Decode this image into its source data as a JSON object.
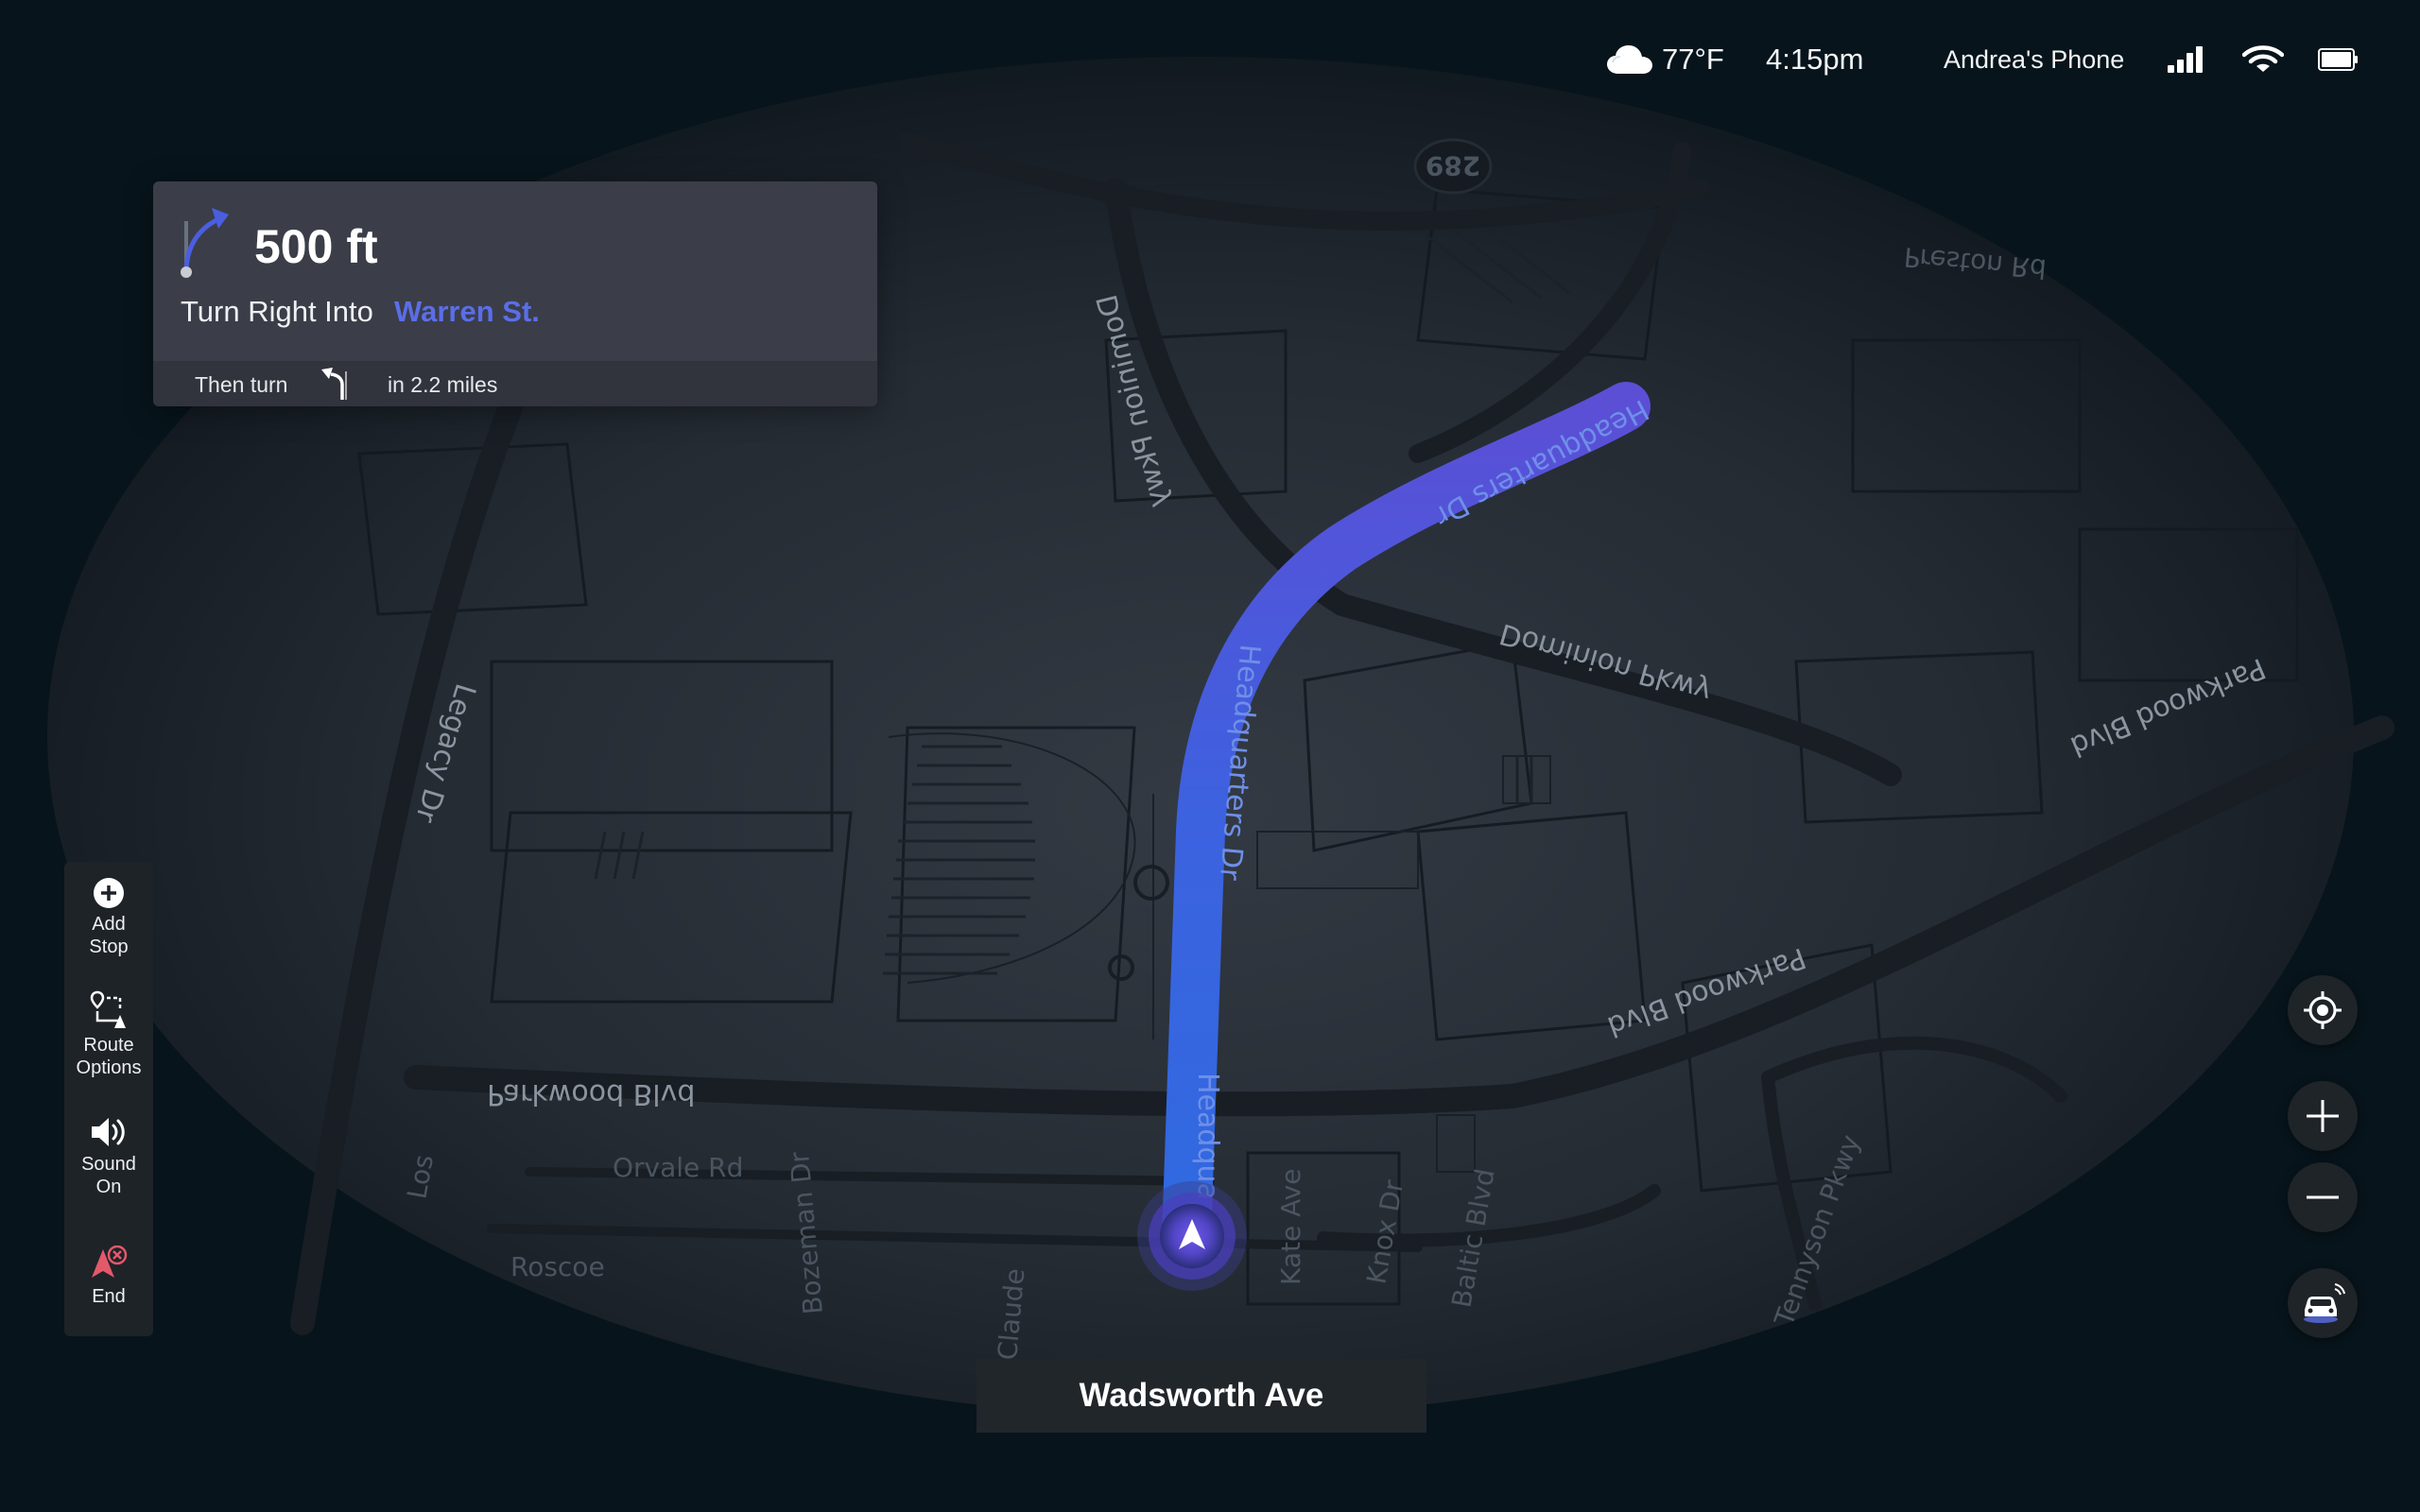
{
  "status_bar": {
    "weather_icon": "cloud-icon",
    "temperature": "77°F",
    "time": "4:15pm",
    "device_name": "Andrea's Phone",
    "signal_icon": "signal-bars-icon",
    "wifi_icon": "wifi-icon",
    "battery_icon": "battery-icon"
  },
  "nav_card": {
    "turn_icon": "turn-right-arrow-icon",
    "distance": "500 ft",
    "instruction": "Turn Right Into",
    "street": "Warren St.",
    "then_label": "Then turn",
    "then_icon": "turn-left-arrow-icon",
    "then_distance": "in 2.2 miles"
  },
  "toolbar": {
    "items": [
      {
        "label_line1": "Add",
        "label_line2": "Stop",
        "icon": "add-circle-icon"
      },
      {
        "label_line1": "Route",
        "label_line2": "Options",
        "icon": "route-options-icon"
      },
      {
        "label_line1": "Sound",
        "label_line2": "On",
        "icon": "speaker-icon"
      },
      {
        "label_line1": "End",
        "icon": "end-navigation-icon",
        "color": "#e2596a"
      }
    ]
  },
  "map_controls": {
    "recenter_icon": "locate-icon",
    "zoom_in_icon": "plus-icon",
    "zoom_out_icon": "minus-icon",
    "vehicle_icon": "connected-car-icon"
  },
  "current_street": "Wadsworth Ave",
  "map_labels": {
    "dominion_pkwy_a": "Dominion Pkwy",
    "dominion_pkwy_b": "Dominion Pkwy",
    "headquarters_dr_a": "Headquarters Dr",
    "headquarters_dr_b": "Headquarters Dr",
    "headquarters_dr_c": "Headqua",
    "parkwood_blvd_a": "Parkwood Blvd",
    "parkwood_blvd_b": "Parkwood Blvd",
    "parkwood_blvd_c": "Parkwood Blvd",
    "legacy_dr": "Legacy Dr",
    "preston_rd": "Preston Rd",
    "orvale_rd": "Orvale Rd",
    "bozeman_dr": "Bozeman Dr",
    "kate_ave": "Kate Ave",
    "knox_dr": "Knox Dr",
    "baltic_blvd": "Baltic Blvd",
    "tennyson_pkwy": "Tennyson Pkwy",
    "claude": "Claude",
    "los": "Los",
    "roscoe": "Roscoe",
    "route_shield": "289"
  },
  "colors": {
    "route": "#3f63e0",
    "accent": "#5b6ee8",
    "end": "#e2596a"
  }
}
